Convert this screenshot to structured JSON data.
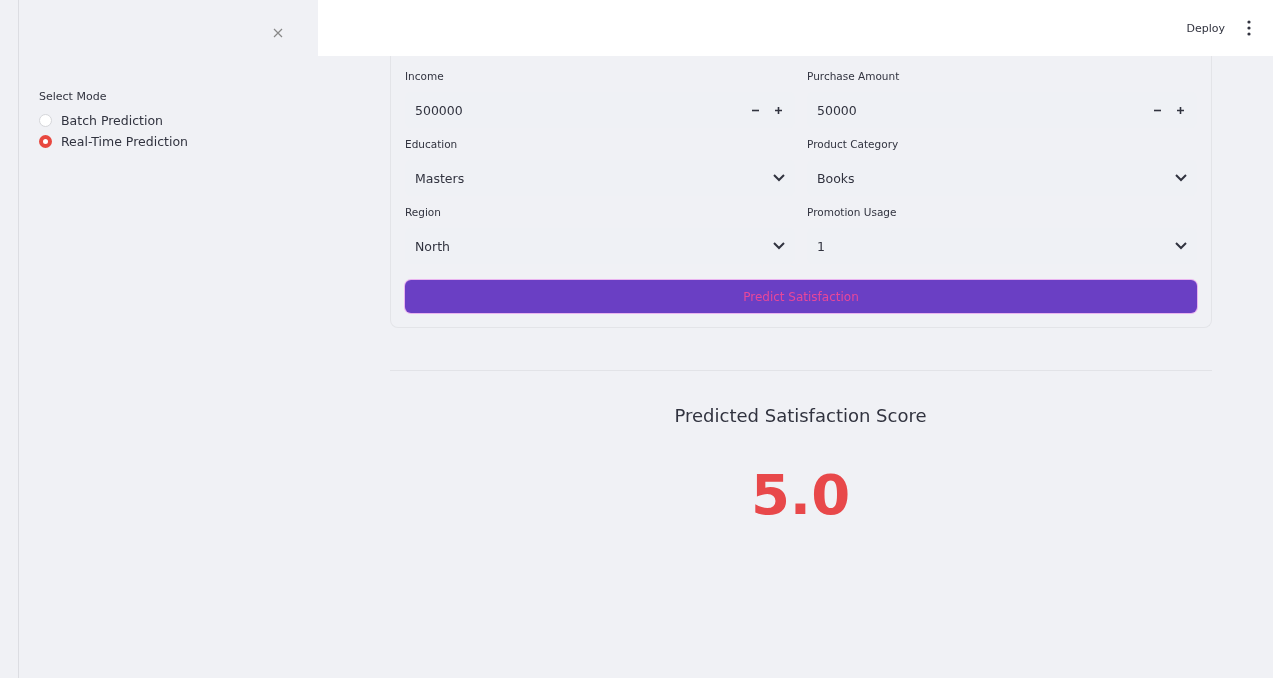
{
  "header": {
    "deploy": "Deploy"
  },
  "sidebar": {
    "mode_label": "Select Mode",
    "options": [
      {
        "label": "Batch Prediction",
        "selected": false
      },
      {
        "label": "Real-Time Prediction",
        "selected": true
      }
    ]
  },
  "form": {
    "fields": [
      {
        "kind": "number",
        "label": "Income",
        "value": "500000"
      },
      {
        "kind": "number",
        "label": "Purchase Amount",
        "value": "50000"
      },
      {
        "kind": "select",
        "label": "Education",
        "value": "Masters"
      },
      {
        "kind": "select",
        "label": "Product Category",
        "value": "Books"
      },
      {
        "kind": "select",
        "label": "Region",
        "value": "North"
      },
      {
        "kind": "select",
        "label": "Promotion Usage",
        "value": "1"
      }
    ],
    "submit": "Predict Satisfaction"
  },
  "result": {
    "title": "Predicted Satisfaction Score",
    "value": "5.0"
  }
}
